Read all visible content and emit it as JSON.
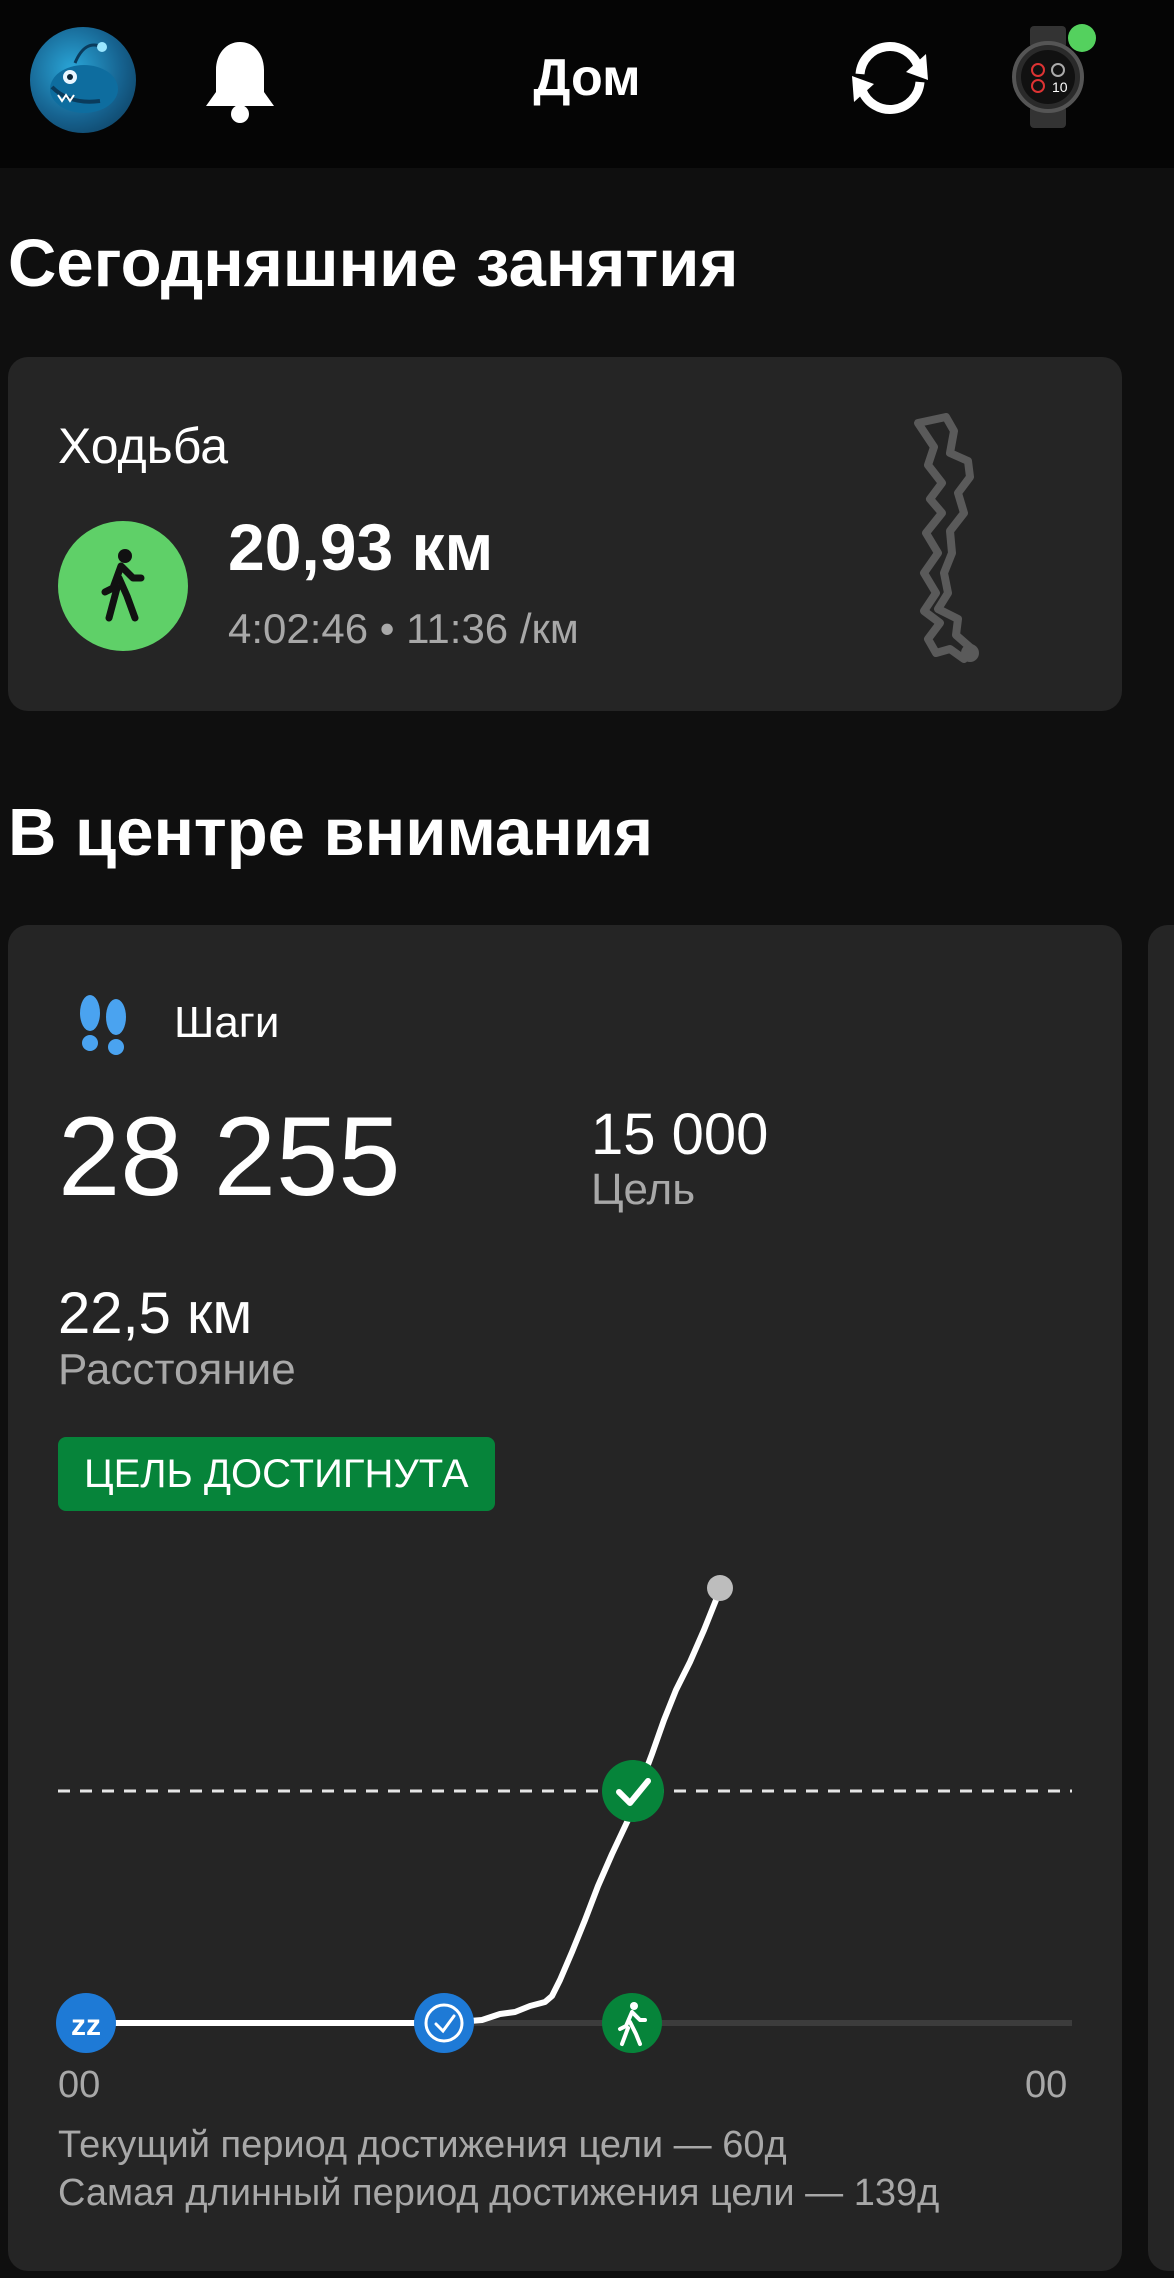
{
  "header": {
    "title": "Дом",
    "avatar_icon": "anglerfish-avatar",
    "bell_icon": "bell-icon",
    "sync_icon": "sync-icon",
    "device_icon": "smartwatch-icon"
  },
  "todays_activities": {
    "section_title": "Сегодняшние занятия",
    "activity": {
      "name": "Ходьба",
      "distance": "20,93 км",
      "details": "4:02:46 • 11:36 /км",
      "icon": "walking-icon",
      "accent": "#5fd068"
    }
  },
  "highlights": {
    "section_title": "В центре внимания",
    "steps": {
      "title": "Шаги",
      "icon": "footprints-icon",
      "count": "28 255",
      "goal_value": "15 000",
      "goal_label": "Цель",
      "distance_value": "22,5 км",
      "distance_label": "Расстояние",
      "goal_badge": "ЦЕЛЬ ДОСТИГНУТА",
      "chart_start_label": "00",
      "chart_end_label": "00",
      "streak_current": "Текущий период достижения цели — 60д",
      "streak_longest": "Самая длинный период достижения цели — 139д",
      "accent_green": "#06843a",
      "accent_blue": "#1e7ad6"
    }
  }
}
